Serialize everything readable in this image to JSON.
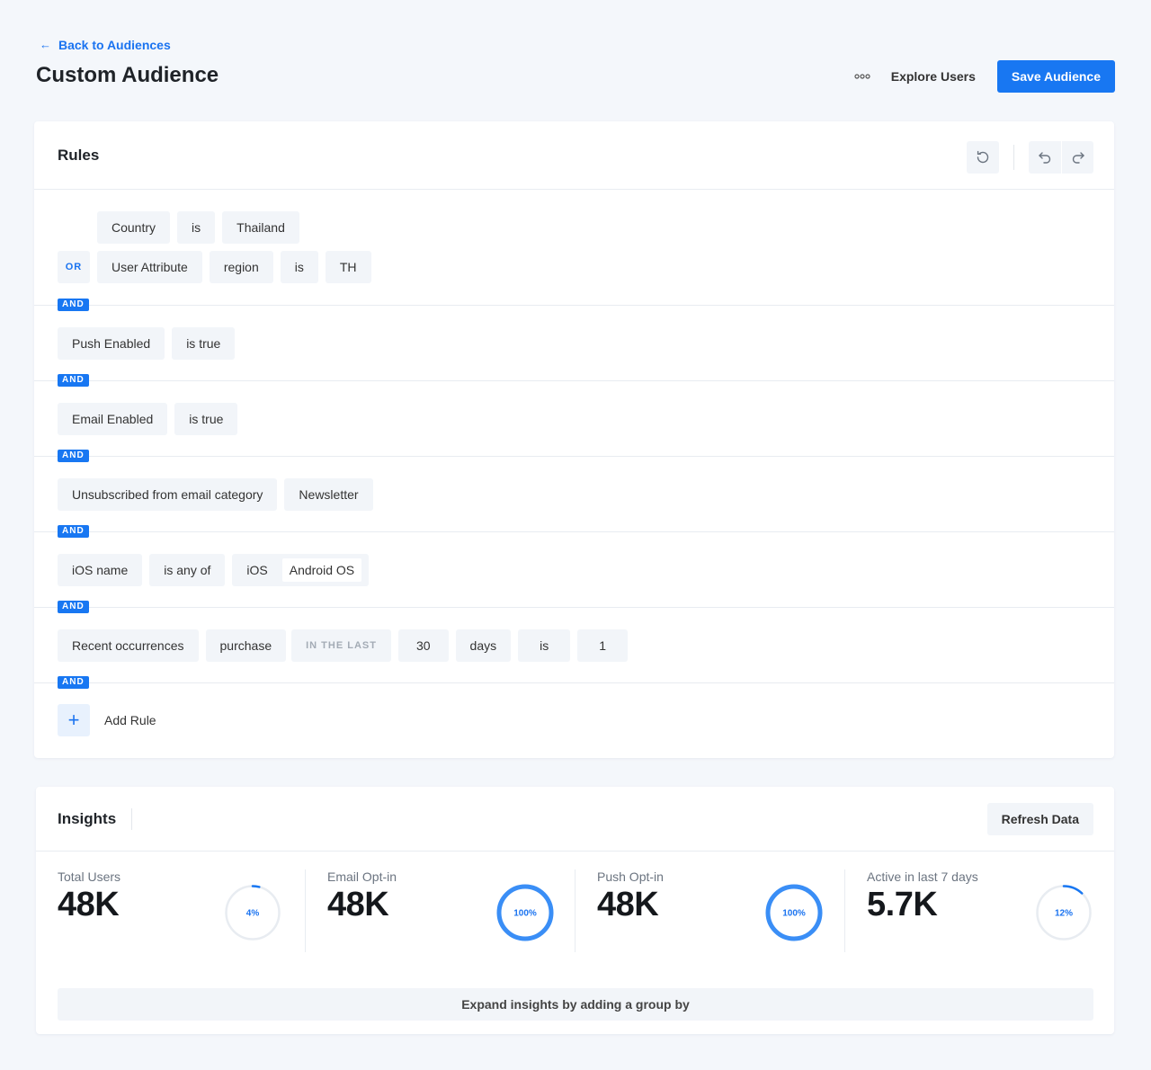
{
  "header": {
    "back_label": "Back to Audiences",
    "title": "Custom Audience",
    "more_icon": "more-horizontal-icon",
    "explore_label": "Explore Users",
    "save_label": "Save Audience"
  },
  "rules": {
    "title": "Rules",
    "connector": "AND",
    "group1": {
      "row1": [
        "Country",
        "is",
        "Thailand"
      ],
      "or_label": "OR",
      "row2": [
        "User Attribute",
        "region",
        "is",
        "TH"
      ]
    },
    "push": [
      "Push Enabled",
      "is true"
    ],
    "email": [
      "Email Enabled",
      "is true"
    ],
    "unsub": [
      "Unsubscribed from email category",
      "Newsletter"
    ],
    "ios": [
      "iOS name",
      "is any of"
    ],
    "ios_values": [
      "iOS",
      "Android OS"
    ],
    "recent": {
      "attribute": "Recent occurrences",
      "event": "purchase",
      "window_label": "IN THE LAST",
      "count": "30",
      "unit": "days",
      "op": "is",
      "value": "1"
    },
    "add_label": "Add Rule"
  },
  "insights": {
    "title": "Insights",
    "refresh_label": "Refresh Data",
    "metrics": [
      {
        "label": "Total Users",
        "value": "48K",
        "percent": 4,
        "percent_label": "4%"
      },
      {
        "label": "Email Opt-in",
        "value": "48K",
        "percent": 100,
        "percent_label": "100%"
      },
      {
        "label": "Push Opt-in",
        "value": "48K",
        "percent": 100,
        "percent_label": "100%"
      },
      {
        "label": "Active in last 7 days",
        "value": "5.7K",
        "percent": 12,
        "percent_label": "12%"
      }
    ],
    "expand_label": "Expand insights by adding a group by"
  },
  "colors": {
    "accent": "#1877f2",
    "ring_track": "#e8ecf1",
    "page_bg": "#f4f7fb"
  }
}
